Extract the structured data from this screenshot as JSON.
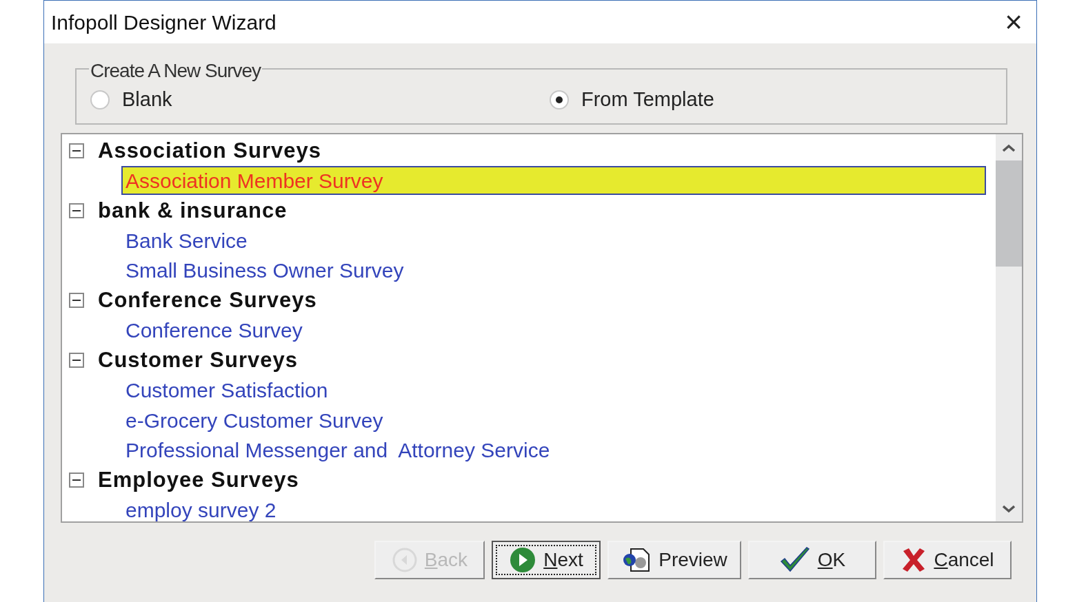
{
  "window": {
    "title": "Infopoll Designer Wizard",
    "close": "×"
  },
  "create_group": {
    "legend": "Create A New Survey",
    "options": [
      {
        "label": "Blank",
        "selected": false
      },
      {
        "label": "From Template",
        "selected": true
      }
    ]
  },
  "tree": [
    {
      "label": "Association Surveys",
      "expanded": true,
      "children": [
        {
          "label": "Association Member Survey",
          "selected": true
        }
      ]
    },
    {
      "label": "bank & insurance",
      "expanded": true,
      "children": [
        {
          "label": "Bank Service",
          "selected": false
        },
        {
          "label": "Small Business Owner Survey",
          "selected": false
        }
      ]
    },
    {
      "label": "Conference Surveys",
      "expanded": true,
      "children": [
        {
          "label": "Conference Survey",
          "selected": false
        }
      ]
    },
    {
      "label": "Customer Surveys",
      "expanded": true,
      "children": [
        {
          "label": "Customer Satisfaction",
          "selected": false
        },
        {
          "label": "e-Grocery Customer Survey",
          "selected": false
        },
        {
          "label": "Professional Messenger and  Attorney Service",
          "selected": false
        }
      ]
    },
    {
      "label": "Employee Surveys",
      "expanded": true,
      "children": [
        {
          "label": "employ survey 2",
          "selected": false
        }
      ]
    }
  ],
  "buttons": [
    {
      "kind": "back",
      "label": "Back",
      "access_key_underlined": true,
      "disabled": true,
      "focused": false
    },
    {
      "kind": "next",
      "label": "Next",
      "access_key_underlined": true,
      "disabled": false,
      "focused": true
    },
    {
      "kind": "preview",
      "label": "Preview",
      "access_key_underlined": false,
      "disabled": false,
      "focused": false
    },
    {
      "kind": "ok",
      "label": "OK",
      "access_key_underlined": true,
      "disabled": false,
      "focused": false
    },
    {
      "kind": "cancel",
      "label": "Cancel",
      "access_key_underlined": true,
      "disabled": false,
      "focused": false
    }
  ]
}
